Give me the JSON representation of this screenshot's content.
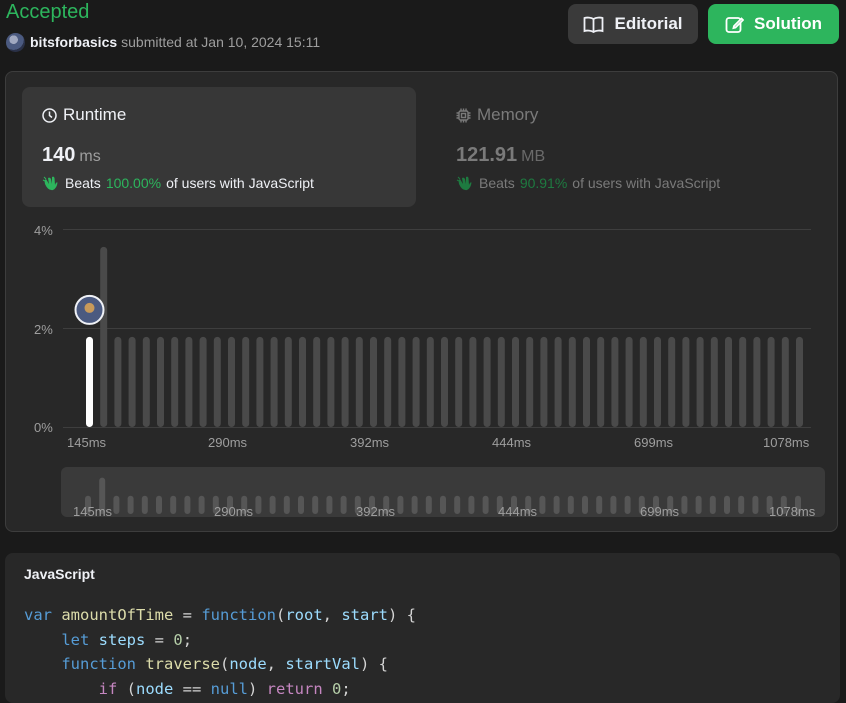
{
  "header": {
    "status": "Accepted",
    "username": "bitsforbasics",
    "submitted_text": "submitted at Jan 10, 2024 15:11",
    "editorial_label": "Editorial",
    "solution_label": "Solution"
  },
  "runtime": {
    "title": "Runtime",
    "value": "140",
    "unit": "ms",
    "beats_prefix": "Beats",
    "beats_pct": "100.00%",
    "beats_suffix": "of users with JavaScript"
  },
  "memory": {
    "title": "Memory",
    "value": "121.91",
    "unit": "MB",
    "beats_prefix": "Beats",
    "beats_pct": "90.91%",
    "beats_suffix": "of users with JavaScript"
  },
  "chart_data": {
    "type": "bar",
    "ylabel": "",
    "xlabel": "",
    "y_ticks": [
      "4%",
      "2%",
      "0%"
    ],
    "ylim": [
      0,
      4
    ],
    "x_tick_labels": [
      "145ms",
      "290ms",
      "392ms",
      "444ms",
      "699ms",
      "1078ms"
    ],
    "bar_count": 51,
    "highlight_bar_index": 0,
    "values": [
      1.82,
      3.64,
      1.82,
      1.82,
      1.82,
      1.82,
      1.82,
      1.82,
      1.82,
      1.82,
      1.82,
      1.82,
      1.82,
      1.82,
      1.82,
      1.82,
      1.82,
      1.82,
      1.82,
      1.82,
      1.82,
      1.82,
      1.82,
      1.82,
      1.82,
      1.82,
      1.82,
      1.82,
      1.82,
      1.82,
      1.82,
      1.82,
      1.82,
      1.82,
      1.82,
      1.82,
      1.82,
      1.82,
      1.82,
      1.82,
      1.82,
      1.82,
      1.82,
      1.82,
      1.82,
      1.82,
      1.82,
      1.82,
      1.82,
      1.82,
      1.82
    ],
    "colors": {
      "highlight": "#ffffff",
      "bar": "#4a4a4a",
      "grid": "#3e3e3e"
    }
  },
  "code": {
    "language": "JavaScript"
  },
  "colors": {
    "accent": "#2db55d",
    "background": "#1a1a1a",
    "panel": "#282828"
  }
}
